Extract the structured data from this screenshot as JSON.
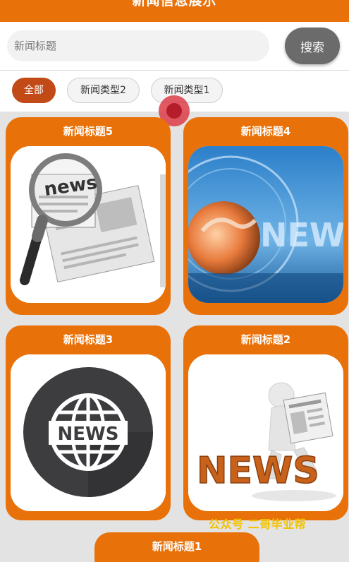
{
  "header": {
    "title": "新闻信息展示"
  },
  "search": {
    "placeholder": "新闻标题",
    "button_label": "搜索"
  },
  "filters": [
    {
      "label": "全部",
      "selected": true
    },
    {
      "label": "新闻类型2",
      "selected": false
    },
    {
      "label": "新闻类型1",
      "selected": false
    }
  ],
  "cards": [
    {
      "title": "新闻标题5",
      "image": "magnifier-newspaper-image"
    },
    {
      "title": "新闻标题4",
      "image": "globe-news-image"
    },
    {
      "title": "新闻标题3",
      "image": "news-globe-badge-image"
    },
    {
      "title": "新闻标题2",
      "image": "3d-figure-reading-news-image"
    },
    {
      "title": "新闻标题1",
      "image": ""
    }
  ],
  "watermark": "公众号 二哥毕业帮",
  "colors": {
    "accent": "#e8710a",
    "chip_active": "#c24a16",
    "button": "#6b6b6b",
    "watermark": "#f2c200"
  }
}
